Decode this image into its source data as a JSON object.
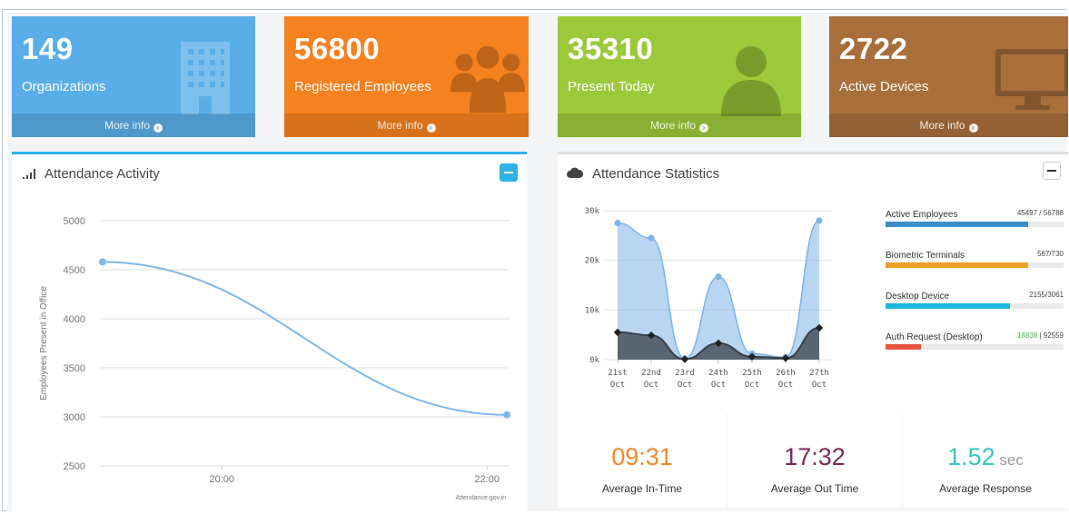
{
  "tiles": [
    {
      "value": "149",
      "label": "Organizations",
      "more": "More info",
      "color": "#5aaee8",
      "icon": "building-icon"
    },
    {
      "value": "56800",
      "label": "Registered Employees",
      "more": "More info",
      "color": "#f5811f",
      "icon": "users-group-icon"
    },
    {
      "value": "35310",
      "label": "Present Today",
      "more": "More info",
      "color": "#9cc93a",
      "icon": "user-icon"
    },
    {
      "value": "2722",
      "label": "Active Devices",
      "more": "More info",
      "color": "#a86f3b",
      "icon": "monitor-icon"
    }
  ],
  "activity_panel": {
    "title": "Attendance Activity",
    "icon": "signal-bars-icon",
    "accent": "#2fb3e4",
    "watermark": "Attendance.gov.in"
  },
  "stats_panel": {
    "title": "Attendance Statistics",
    "icon": "cloud-icon"
  },
  "chart_data": [
    {
      "type": "line",
      "title": "Attendance Activity",
      "xlabel": "",
      "ylabel": "Employees Present in Office",
      "x_ticks": [
        "20:00",
        "22:00"
      ],
      "y_ticks": [
        2500,
        3000,
        3500,
        4000,
        4500,
        5000
      ],
      "ylim": [
        2500,
        5000
      ],
      "xlim_hours": [
        19.08,
        22.17
      ],
      "series": [
        {
          "points": [
            {
              "x": "19:05",
              "xh": 19.1,
              "y": 4580
            },
            {
              "x": "22:09",
              "xh": 22.15,
              "y": 3020
            }
          ],
          "color": "#7fb8e8"
        }
      ],
      "grid": true
    },
    {
      "type": "area",
      "title": "Attendance Statistics",
      "categories": [
        "21st Oct",
        "22nd Oct",
        "23rd Oct",
        "24th Oct",
        "25th Oct",
        "26th Oct",
        "27th Oct"
      ],
      "y_ticks": [
        "0k",
        "10k",
        "20k",
        "30k"
      ],
      "ylim": [
        0,
        30000
      ],
      "series": [
        {
          "values": [
            27500,
            24500,
            200,
            16700,
            1200,
            500,
            28000
          ],
          "color": "#7db3e8"
        },
        {
          "values": [
            5500,
            4900,
            100,
            3300,
            600,
            300,
            6400
          ],
          "color": "#3a3f47"
        }
      ],
      "grid": true
    }
  ],
  "progress_items": [
    {
      "label": "Active Employees",
      "value": "45497 / 56788",
      "fraction": 0.8,
      "color": "#3a8fc9",
      "value_color": "#444"
    },
    {
      "label": "Biometric Terminals",
      "value": "567/730",
      "fraction": 0.8,
      "color": "#f0a020",
      "value_color": "#444"
    },
    {
      "label": "Desktop Device",
      "value": "2155/3061",
      "fraction": 0.7,
      "color": "#1ab6de",
      "value_color": "#444"
    },
    {
      "label": "Auth Request (Desktop)",
      "value_a": "18838",
      "value_b": " | 92559",
      "fraction": 0.2,
      "color": "#e8553e",
      "value_color": "#4caf50"
    }
  ],
  "summary_stats": [
    {
      "value": "09:31",
      "unit": "",
      "label": "Average In-Time",
      "color": "#f08a2c"
    },
    {
      "value": "17:32",
      "unit": "",
      "label": "Average Out Time",
      "color": "#7a2a5a"
    },
    {
      "value": "1.52",
      "unit": " sec",
      "label": "Average Response",
      "color": "#3cc4c0"
    }
  ]
}
